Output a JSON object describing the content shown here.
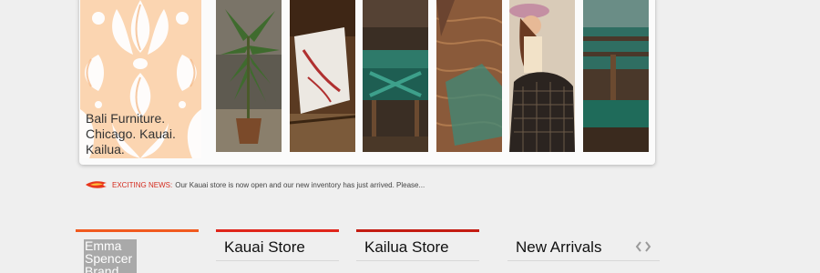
{
  "hero": {
    "tagline_lines": [
      "Bali Furniture.",
      "Chicago. Kauai.",
      "Kailua."
    ]
  },
  "news": {
    "label": "EXCITING NEWS:",
    "text": "Our Kauai store is now open and our new inventory has just arrived.  Please..."
  },
  "columns": {
    "emma": {
      "title": "Emma Spencer Brand",
      "bar_color": "#f15a1f"
    },
    "kauai": {
      "title": "Kauai Store",
      "bar_color": "#e0261b"
    },
    "kailua": {
      "title": "Kailua Store",
      "bar_color": "#c41c12"
    },
    "arrivals": {
      "title": "New Arrivals"
    }
  },
  "icons": {
    "news": "flame-icon",
    "prev": "chevron-left-icon",
    "next": "chevron-right-icon"
  },
  "colors": {
    "background": "#efefef",
    "pattern": "#fbd5b1",
    "news_label": "#d42b1e"
  }
}
